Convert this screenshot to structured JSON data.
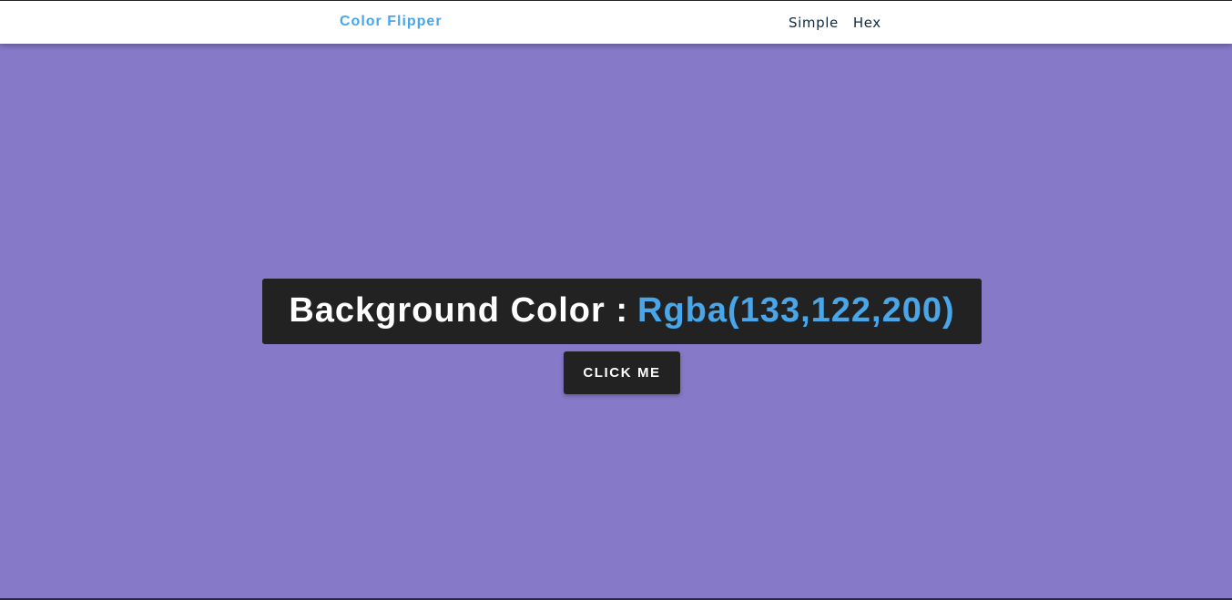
{
  "navbar": {
    "brand": "Color Flipper",
    "links": [
      {
        "label": "Simple"
      },
      {
        "label": "Hex"
      }
    ]
  },
  "main": {
    "label_prefix": "Background Color :",
    "color_value": "Rgba(133,122,200)",
    "button_label": "click me"
  },
  "colors": {
    "background": "#8579c8",
    "accent": "#49a6e9",
    "dark": "#222222",
    "nav_text": "#102a42"
  }
}
